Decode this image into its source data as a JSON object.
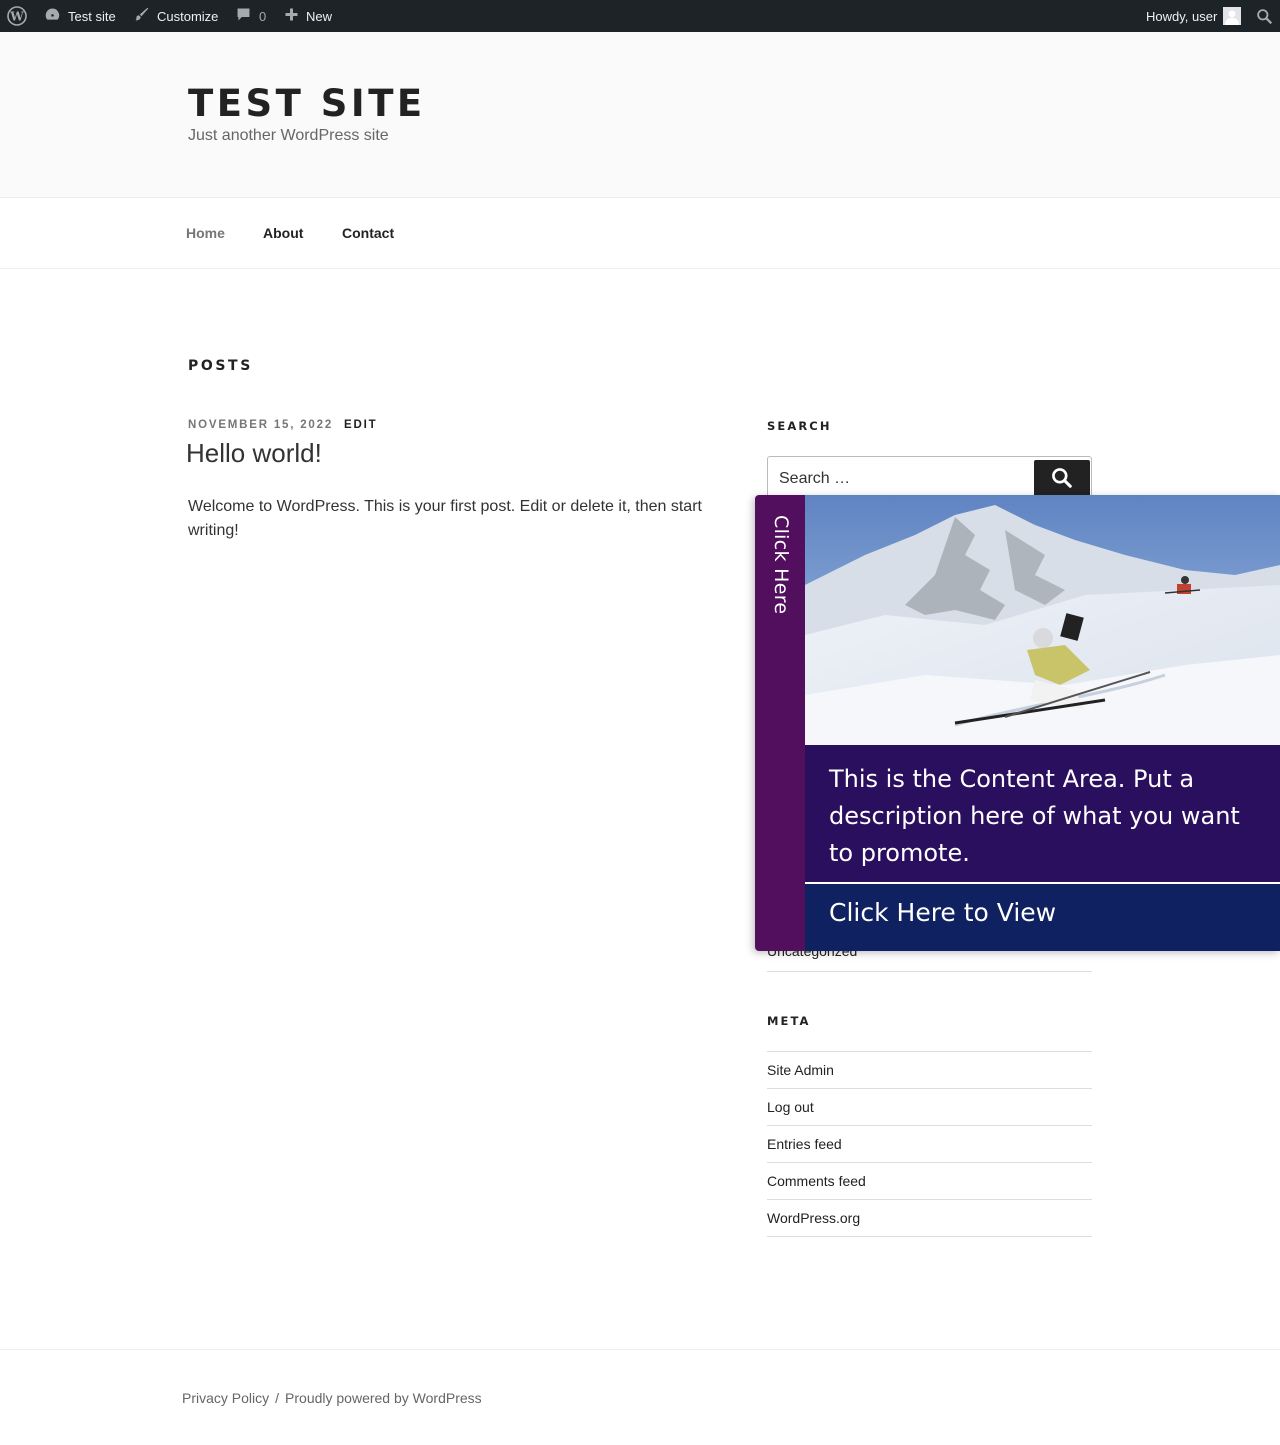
{
  "adminbar": {
    "site_name": "Test site",
    "customize": "Customize",
    "comments_count": "0",
    "new": "New",
    "greeting": "Howdy, user"
  },
  "header": {
    "site_title": "TEST SITE",
    "tagline": "Just another WordPress site"
  },
  "nav": {
    "items": [
      {
        "label": "Home",
        "current": true
      },
      {
        "label": "About"
      },
      {
        "label": "Contact"
      }
    ]
  },
  "main": {
    "heading": "POSTS",
    "post": {
      "date": "NOVEMBER 15, 2022",
      "edit": "EDIT",
      "title": "Hello world!",
      "excerpt": "Welcome to WordPress. This is your first post. Edit or delete it, then start writing!"
    }
  },
  "sidebar": {
    "search_title": "SEARCH",
    "search_placeholder": "Search …",
    "category_item": "Uncategorized",
    "meta_title": "META",
    "meta_links": [
      "Site Admin",
      "Log out",
      "Entries feed",
      "Comments feed",
      "WordPress.org"
    ]
  },
  "promo": {
    "tab_label": "Click Here",
    "content_text": "This is the Content Area. Put a description here of what you want to promote.",
    "cta_label": "Click Here to View",
    "colors": {
      "tab": "#520f5e",
      "content": "#2a0f5e",
      "cta": "#0f2160"
    }
  },
  "footer": {
    "privacy": "Privacy Policy",
    "separator": "/",
    "powered": "Proudly powered by WordPress"
  }
}
